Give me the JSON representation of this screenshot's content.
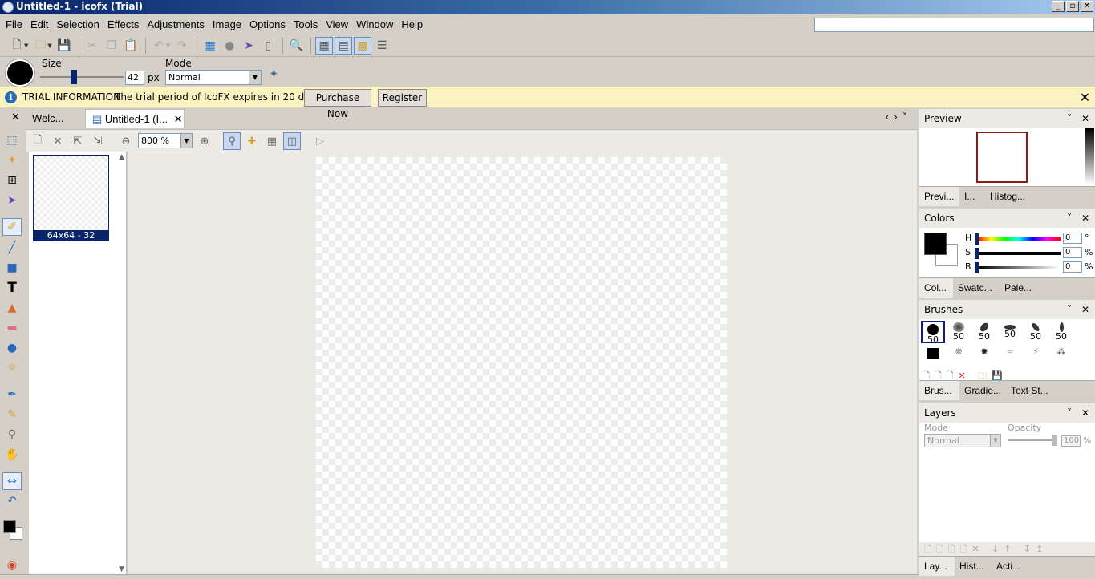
{
  "window": {
    "title": "Untitled-1 - icofx (Trial)",
    "buttons": [
      "_",
      "▫",
      "✕"
    ]
  },
  "menu": [
    "File",
    "Edit",
    "Selection",
    "Effects",
    "Adjustments",
    "Image",
    "Options",
    "Tools",
    "View",
    "Window",
    "Help"
  ],
  "options_bar": {
    "size_label": "Size",
    "size_value": "42",
    "size_unit": "px",
    "mode_label": "Mode",
    "mode_value": "Normal",
    "size_fraction": 0.4
  },
  "trial": {
    "title": "TRIAL INFORMATION",
    "message": "The trial period of IcoFX expires in 20 days.",
    "purchase_label": "Purchase Now",
    "register_label": "Register"
  },
  "doc_tabs": [
    {
      "label": "Welc..."
    },
    {
      "label": "Untitled-1 (I..."
    }
  ],
  "zoom": "800 %",
  "thumbnail": {
    "label": "64x64 - 32"
  },
  "panels": {
    "preview": {
      "title": "Preview",
      "tabs": [
        "Previ...",
        "I...",
        "Histog..."
      ]
    },
    "colors": {
      "title": "Colors",
      "rows": [
        {
          "label": "H",
          "value": "0",
          "unit": "°"
        },
        {
          "label": "S",
          "value": "0",
          "unit": "%"
        },
        {
          "label": "B",
          "value": "0",
          "unit": "%"
        }
      ],
      "tabs": [
        "Col...",
        "Swatc...",
        "Pale..."
      ]
    },
    "brushes": {
      "title": "Brushes",
      "row1": [
        "50",
        "50",
        "50",
        "50",
        "50",
        "50"
      ],
      "tabs": [
        "Brus...",
        "Gradie...",
        "Text St..."
      ]
    },
    "layers": {
      "title": "Layers",
      "mode_label": "Mode",
      "opacity_label": "Opacity",
      "mode_value": "Normal",
      "opacity_value": "100",
      "opacity_unit": "%",
      "tabs": [
        "Lay...",
        "Hist...",
        "Acti..."
      ]
    }
  },
  "colors": {
    "accent": "#0a246a",
    "trial_bg": "#fbf3c0",
    "preview_border": "#8b1a1a"
  }
}
